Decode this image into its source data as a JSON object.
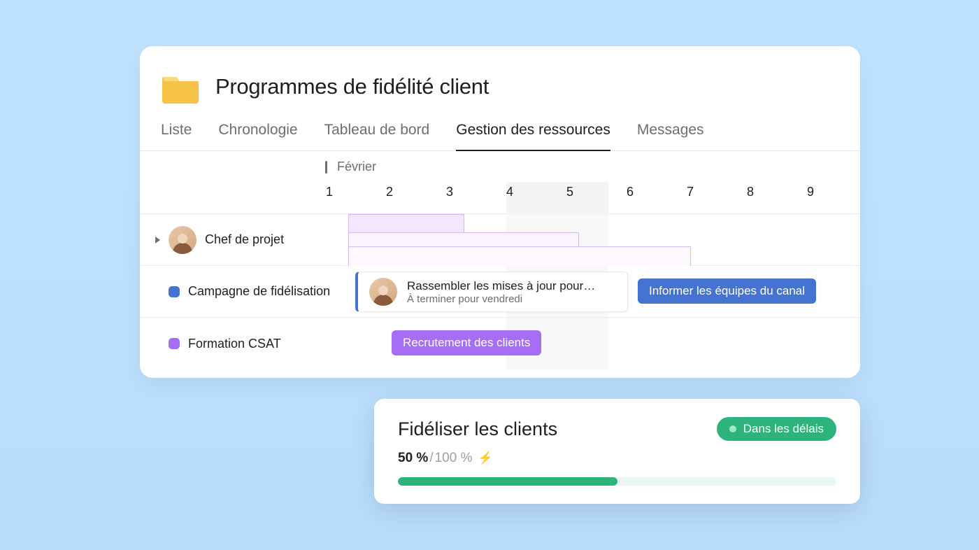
{
  "header": {
    "title": "Programmes de fidélité client"
  },
  "tabs": [
    {
      "label": "Liste",
      "active": false
    },
    {
      "label": "Chronologie",
      "active": false
    },
    {
      "label": "Tableau de bord",
      "active": false
    },
    {
      "label": "Gestion des ressources",
      "active": true
    },
    {
      "label": "Messages",
      "active": false
    }
  ],
  "timeline": {
    "month": "Février",
    "days": [
      "1",
      "2",
      "3",
      "4",
      "5",
      "6",
      "7",
      "8",
      "9"
    ],
    "today_range": [
      4,
      5
    ]
  },
  "rows": [
    {
      "type": "person",
      "label": "Chef de projet"
    },
    {
      "type": "project",
      "chip": "blue",
      "label": "Campagne de fidélisation"
    },
    {
      "type": "project",
      "chip": "purple",
      "label": "Formation CSAT"
    }
  ],
  "tasks": {
    "card": {
      "title": "Rassembler les mises à jour pour…",
      "subtitle": "À terminer pour vendredi"
    },
    "inform_pill": "Informer les équipes du canal",
    "recruit_pill": "Recrutement des clients"
  },
  "goal": {
    "title": "Fidéliser les clients",
    "status": "Dans les délais",
    "current": "50 %",
    "separator": "/",
    "target": "100 %",
    "progress_percent": 50
  },
  "colors": {
    "blue": "#4573d2",
    "purple": "#a66ef5",
    "green": "#2db47d",
    "folder": "#f6c347"
  }
}
